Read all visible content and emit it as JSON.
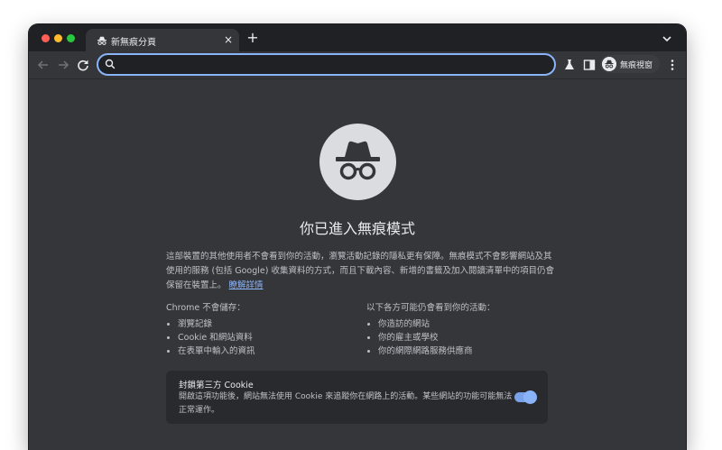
{
  "tab": {
    "title": "新無痕分頁",
    "close_label": "×",
    "new_tab_label": "+"
  },
  "omnibox": {
    "value": "",
    "placeholder": ""
  },
  "profile": {
    "label": "無痕視窗"
  },
  "page": {
    "title": "你已進入無痕模式",
    "intro_text": "這部裝置的其他使用者不會看到你的活動，瀏覽活動記錄的隱私更有保障。無痕模式不會影響網站及其使用的服務 (包括 Google) 收集資料的方式，而且下載內容、新增的書籤及加入閱讀清單中的項目仍會保留在裝置上。",
    "learn_more": "瞭解詳情",
    "not_saved": {
      "heading": "Chrome 不會儲存：",
      "items": [
        "瀏覽記錄",
        "Cookie 和網站資料",
        "在表單中輸入的資訊"
      ]
    },
    "may_see": {
      "heading": "以下各方可能仍會看到你的活動：",
      "items": [
        "你造訪的網站",
        "你的雇主或學校",
        "你的網際網路服務供應商"
      ]
    },
    "cookie_card": {
      "title": "封鎖第三方 Cookie",
      "description": "開啟這項功能後，網站無法使用 Cookie 來追蹤你在網路上的活動。某些網站的功能可能無法正常運作。",
      "toggle_on": true
    }
  },
  "colors": {
    "accent": "#8ab4f8",
    "window_bg": "#35363a",
    "titlebar_bg": "#202124"
  }
}
